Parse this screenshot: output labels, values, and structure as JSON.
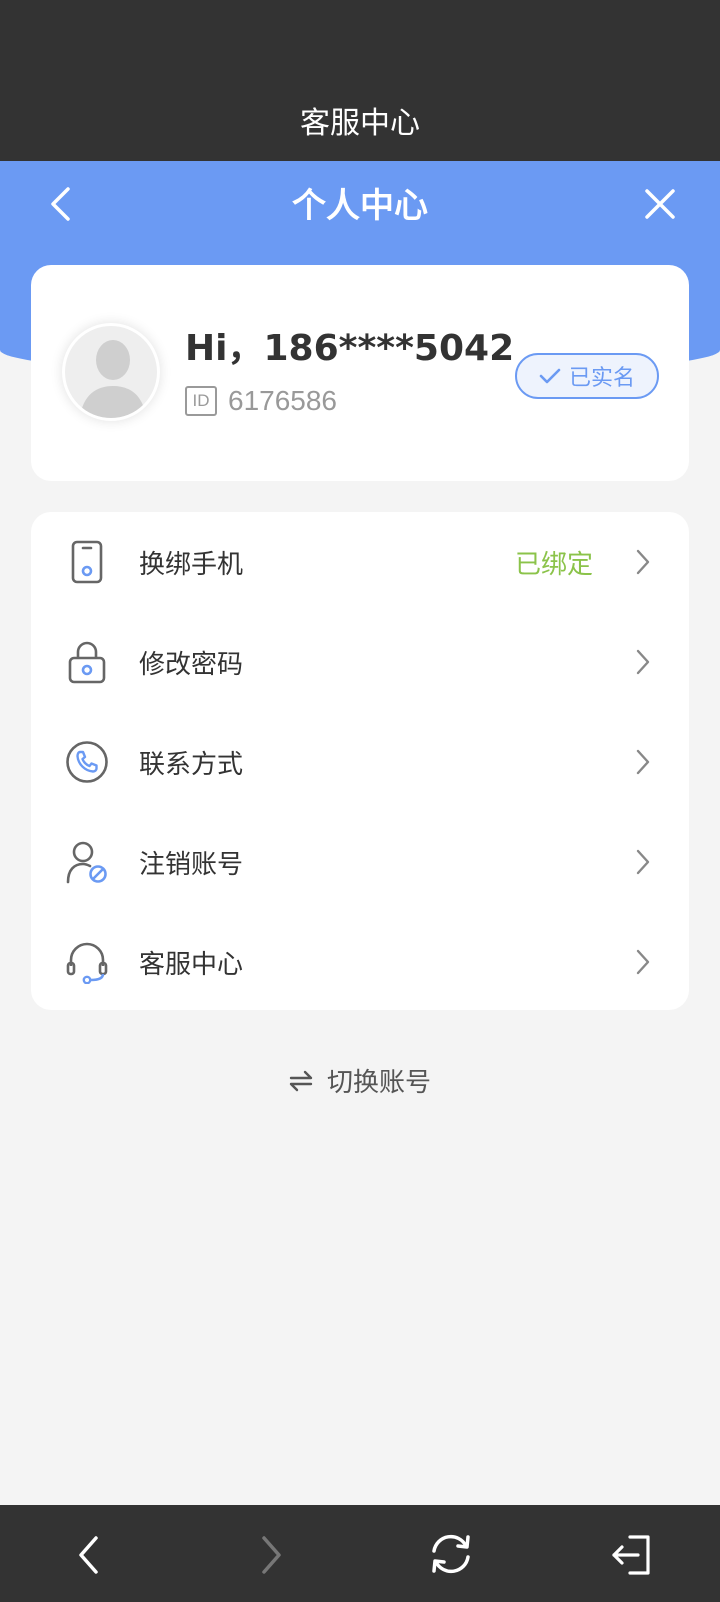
{
  "topbar": {
    "title": "客服中心"
  },
  "header": {
    "title": "个人中心",
    "back_icon": "chevron-left-icon",
    "close_icon": "close-icon"
  },
  "profile": {
    "greeting": "Hi，186****5042",
    "id_badge": "ID",
    "id_value": "6176586",
    "verified_label": "已实名"
  },
  "menu": {
    "items": [
      {
        "label": "换绑手机",
        "status": "已绑定",
        "icon": "phone-icon"
      },
      {
        "label": "修改密码",
        "status": "",
        "icon": "lock-icon"
      },
      {
        "label": "联系方式",
        "status": "",
        "icon": "call-icon"
      },
      {
        "label": "注销账号",
        "status": "",
        "icon": "user-cancel-icon"
      },
      {
        "label": "客服中心",
        "status": "",
        "icon": "headset-icon"
      }
    ]
  },
  "switch_account": {
    "label": "切换账号",
    "icon": "swap-icon"
  },
  "colors": {
    "accent": "#6b9af3",
    "bound_status": "#8bc34a",
    "dark_bar": "#333333",
    "background": "#f4f4f4"
  }
}
